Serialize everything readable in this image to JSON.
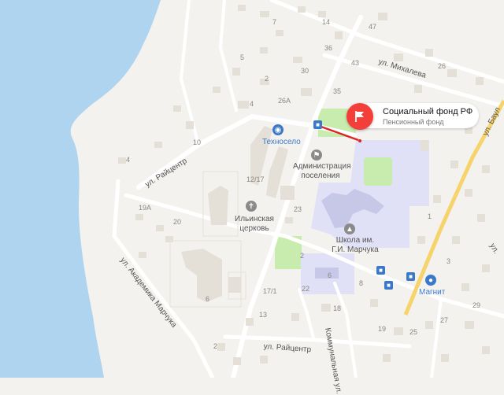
{
  "map": {
    "colors": {
      "water": "#aed4f0",
      "land": "#f4f2ee",
      "road": "#ffffff",
      "building": "#e4e0d8",
      "park": "#c8ebae",
      "school_area": "#e0e0f6",
      "school_bld": "#c7c7e8",
      "highway": "#f7d36b",
      "route": "#e0231f"
    },
    "selected_place": {
      "name": "Социальный фонд РФ",
      "subtitle": "Пенсионный фонд",
      "icon": "flag-icon"
    },
    "streets": {
      "raitsentr": "ул. Райцентр",
      "raitsentr_south": "ул. Райцентр",
      "mikhaleva": "ул. Михалева",
      "marchuka": "ул. Академика Марчука",
      "kommunalnaya": "Коммунальная ул.",
      "baul": "ул. Баул",
      "edge": "ул."
    },
    "pois": {
      "tekhnoselo": "Техносело",
      "administration": "Администрация поселения",
      "church": "Ильинская церковь",
      "school": "Школа им. Г.И. Марчука",
      "magnit": "Магнит"
    },
    "house_numbers": {
      "h7": "7",
      "h14": "14",
      "h47": "47",
      "h36": "36",
      "h43": "43",
      "h5": "5",
      "h26": "26",
      "h30": "30",
      "h2a": "2",
      "h35": "35",
      "h4a": "4",
      "h26A": "26А",
      "h10": "10",
      "h1217": "12/17",
      "h23": "23",
      "h19A": "19А",
      "h4b": "4",
      "h20": "20",
      "h2b": "2",
      "h6a": "6",
      "h6b": "6",
      "h8": "8",
      "h22": "22",
      "h171": "17/1",
      "h13": "13",
      "h2c": "2",
      "h18": "18",
      "h29": "29",
      "h27": "27",
      "h19": "19",
      "h25": "25",
      "h1": "1",
      "h3": "3"
    }
  }
}
